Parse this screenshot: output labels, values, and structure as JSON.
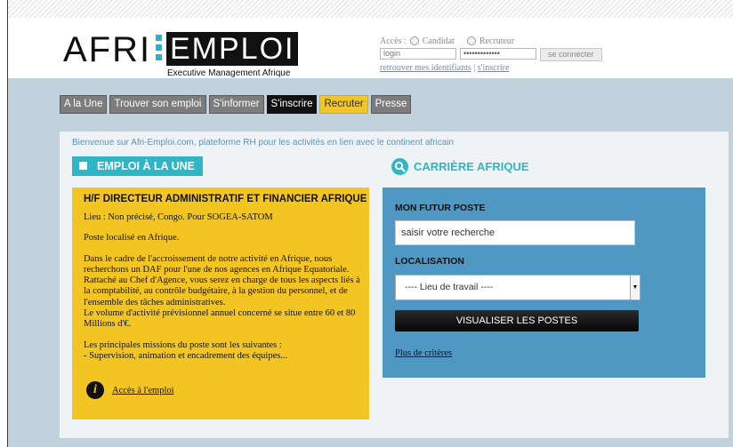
{
  "logo": {
    "part1": "AFRI",
    "part2": "EMPLOI",
    "tagline": "Executive Management Afrique",
    "dot_color": "#29b3c6"
  },
  "login": {
    "acces_label": "Accès :",
    "candidat": "Candidat",
    "recruteur": "Recruteur",
    "login_placeholder": "login",
    "password_value": "•••••••••••••",
    "connect_button": "se connecter",
    "retrieve_link": "retrouver mes identifiants",
    "separator": "|",
    "signup_link": "s'inscrire"
  },
  "nav": {
    "items": [
      "A la Une",
      "Trouver son emploi",
      "S'informer",
      "S'inscrire",
      "Recruter",
      "Presse"
    ]
  },
  "welcome": "Bienvenue sur Afri-Emploi.com, plateforme RH pour les activités en lien avec le continent africain",
  "emploi": {
    "heading": "EMPLOI À LA UNE",
    "job_title": "H/F DIRECTEUR ADMINISTRATIF ET FINANCIER AFRIQUE",
    "location": "Lieu : Non précisé, Congo. Pour SOGEA-SATOM",
    "intro": "Poste localisé en Afrique.",
    "description": "Dans le cadre de l'accroissement de notre activité en Afrique, nous recherchons un DAF pour l'une de nos agences en Afrique Equatoriale. Rattaché au Chef d'Agence, vous serez en charge de tous les aspects liés à la comptabilité, au contrôle budgétaire, à la gestion du personnel, et de l'ensemble des tâches administratives.",
    "volume": "Le volume d'activité prévisionnel annuel concerné se situe entre 60 et 80 Millions d'€.",
    "missions_intro": "Les principales missions du poste sont les suivantes :",
    "missions_item": "- Supervision, animation et encadrement des équipes...",
    "access_link": "Accès à l'emploi",
    "info_icon": "info-icon"
  },
  "carriere": {
    "heading": "CARRIÈRE AFRIQUE",
    "futur_poste_label": "MON FUTUR POSTE",
    "search_placeholder": "saisir votre recherche",
    "localisation_label": "LOCALISATION",
    "select_value": "---- Lieu de travail ----",
    "visualize_button": "VISUALISER LES POSTES",
    "more_criteria": "Plus de critères"
  },
  "colors": {
    "accent_teal": "#2eb5c6",
    "job_yellow": "#f3c522",
    "career_blue": "#4f98c4",
    "band": "#c2d2dc"
  }
}
